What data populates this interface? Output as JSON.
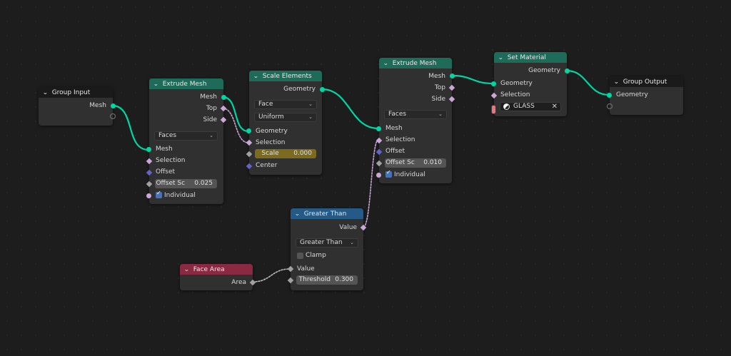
{
  "colors": {
    "background": "#1d1d1d",
    "geometry_socket": "#00d6a3",
    "geometry_header": "#1f6b59",
    "compare_header": "#245a85",
    "input_header": "#8a2a42",
    "boolean_socket": "#cca6d6",
    "vector_socket": "#6363c7",
    "material_socket": "#eb7582"
  },
  "nodes": {
    "group_input": {
      "title": "Group Input",
      "mesh": "Mesh"
    },
    "extrude1": {
      "title": "Extrude Mesh",
      "out_mesh": "Mesh",
      "out_top": "Top",
      "out_side": "Side",
      "mode": "Faces",
      "in_mesh": "Mesh",
      "in_selection": "Selection",
      "in_offset": "Offset",
      "offset_scale_label": "Offset Sc",
      "offset_scale_value": "0.025",
      "individual": "Individual"
    },
    "scale": {
      "title": "Scale Elements",
      "out_geometry": "Geometry",
      "domain": "Face",
      "scale_mode": "Uniform",
      "in_geometry": "Geometry",
      "in_selection": "Selection",
      "scale_label": "Scale",
      "scale_value": "0.000",
      "in_center": "Center"
    },
    "extrude2": {
      "title": "Extrude Mesh",
      "out_mesh": "Mesh",
      "out_top": "Top",
      "out_side": "Side",
      "mode": "Faces",
      "in_mesh": "Mesh",
      "in_selection": "Selection",
      "in_offset": "Offset",
      "offset_scale_label": "Offset Sc",
      "offset_scale_value": "0.010",
      "individual": "Individual"
    },
    "set_material": {
      "title": "Set Material",
      "out_geometry": "Geometry",
      "in_geometry": "Geometry",
      "in_selection": "Selection",
      "material": "GLASS"
    },
    "group_output": {
      "title": "Group Output",
      "geometry": "Geometry"
    },
    "greater": {
      "title": "Greater Than",
      "out_value": "Value",
      "operation": "Greater Than",
      "clamp": "Clamp",
      "in_value": "Value",
      "threshold_label": "Threshold",
      "threshold_value": "0.300"
    },
    "face_area": {
      "title": "Face Area",
      "area": "Area"
    }
  }
}
